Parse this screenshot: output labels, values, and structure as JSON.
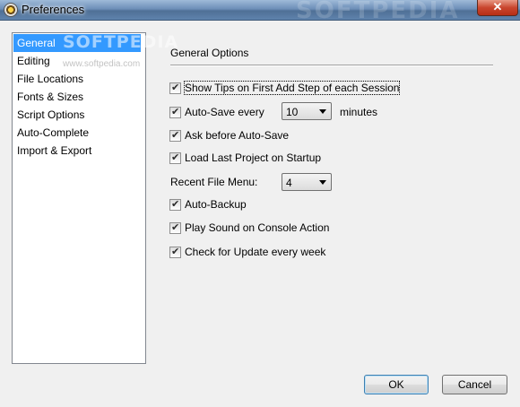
{
  "window": {
    "title": "Preferences",
    "watermark": "SOFTPEDIA"
  },
  "sidebar": {
    "items": [
      {
        "label": "General",
        "selected": true
      },
      {
        "label": "Editing"
      },
      {
        "label": "File Locations"
      },
      {
        "label": "Fonts & Sizes"
      },
      {
        "label": "Script Options"
      },
      {
        "label": "Auto-Complete"
      },
      {
        "label": "Import & Export"
      }
    ],
    "watermark_main": "SOFTPEDIA",
    "watermark_sub": "www.softpedia.com"
  },
  "general": {
    "title": "General Options",
    "show_tips": {
      "label": "Show Tips on First Add Step of each Session",
      "checked": true
    },
    "auto_save": {
      "label": "Auto-Save every",
      "checked": true,
      "interval": "10",
      "unit": "minutes"
    },
    "ask_before_autosave": {
      "label": "Ask before Auto-Save",
      "checked": true
    },
    "load_last_project": {
      "label": "Load Last Project on Startup",
      "checked": true
    },
    "recent_file_menu": {
      "label": "Recent File Menu:",
      "value": "4"
    },
    "auto_backup": {
      "label": "Auto-Backup",
      "checked": true
    },
    "play_sound": {
      "label": "Play Sound on Console Action",
      "checked": true
    },
    "check_update": {
      "label": "Check for Update every week",
      "checked": true
    }
  },
  "buttons": {
    "ok": "OK",
    "cancel": "Cancel"
  },
  "colors": {
    "selection": "#3399ff",
    "title_bar": "#5f83ad",
    "close_button": "#c9462e",
    "background": "#f0f0f0"
  }
}
